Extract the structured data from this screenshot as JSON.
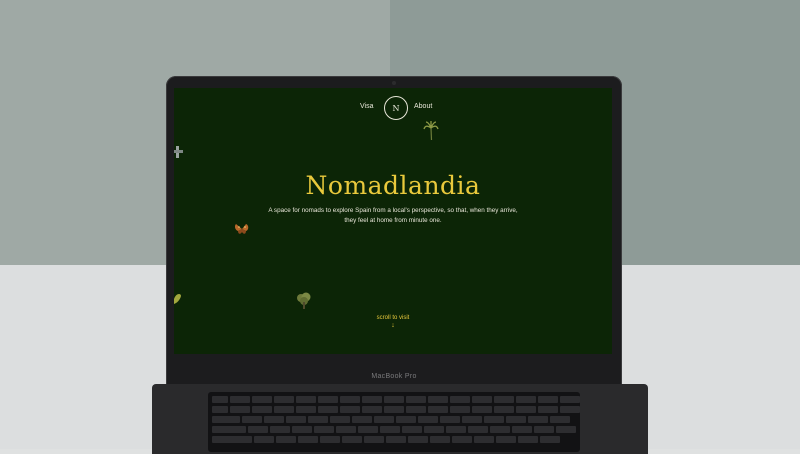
{
  "device": {
    "brand_label": "MacBook Pro"
  },
  "site": {
    "nav": {
      "left_link": "Visa",
      "logo_letter": "N",
      "right_link": "About"
    },
    "hero": {
      "title": "Nomadlandia",
      "subtitle": "A space for nomads to explore Spain from a local's perspective, so that, when they arrive, they feel at home from minute one."
    },
    "scroll_cue": {
      "label": "scroll to visit",
      "arrow": "↓"
    }
  },
  "colors": {
    "screen_bg": "#0c2506",
    "accent_yellow": "#e9c93c",
    "text_light": "#e8e6d8"
  },
  "icons": [
    "palm-tree-icon",
    "butterfly-icon",
    "tree-icon",
    "leaf-icon",
    "insect-icon"
  ]
}
